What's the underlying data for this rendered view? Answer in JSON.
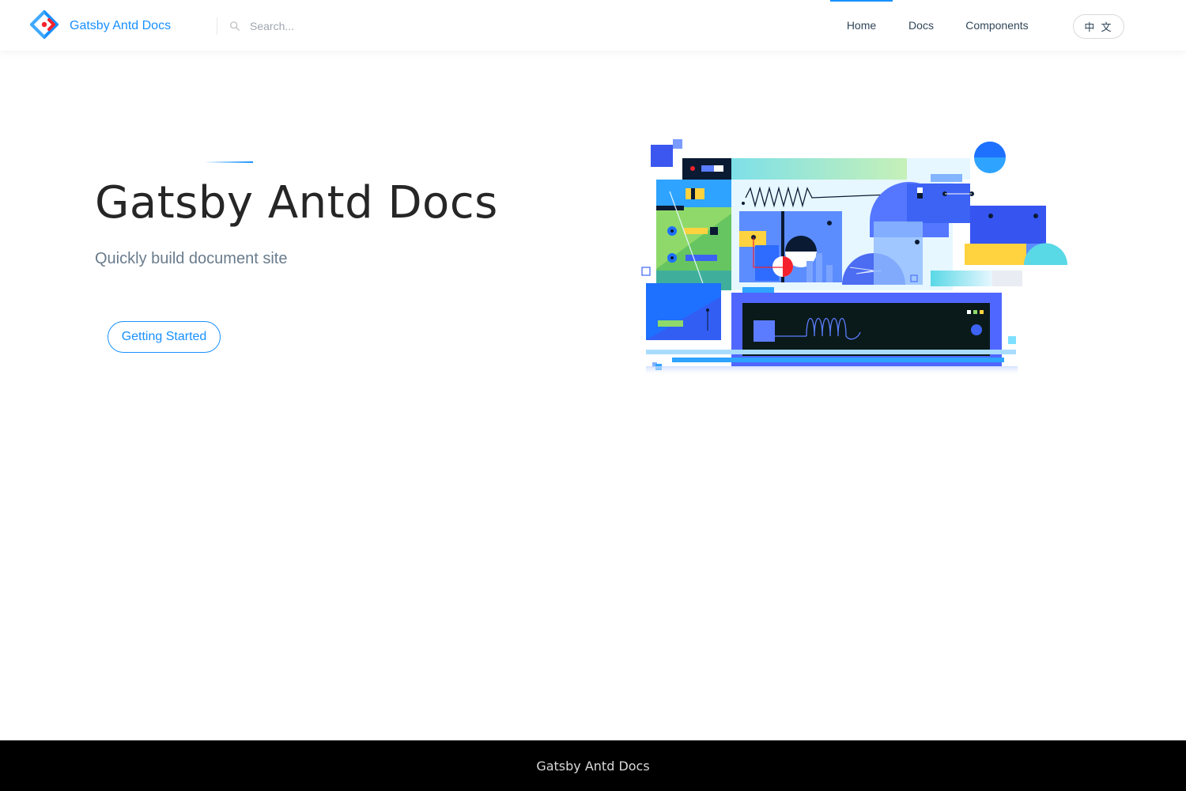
{
  "header": {
    "brand": "Gatsby Antd Docs",
    "search": {
      "placeholder": "Search..."
    },
    "nav": [
      {
        "label": "Home",
        "active": true
      },
      {
        "label": "Docs",
        "active": false
      },
      {
        "label": "Components",
        "active": false
      }
    ],
    "lang_button": "中 文"
  },
  "hero": {
    "title": "Gatsby Antd Docs",
    "subtitle": "Quickly build document site",
    "cta": "Getting Started"
  },
  "footer": {
    "text": "Gatsby Antd Docs"
  },
  "colors": {
    "accent": "#1890ff",
    "footer_bg": "#000000",
    "logo_red": "#f5222d"
  }
}
